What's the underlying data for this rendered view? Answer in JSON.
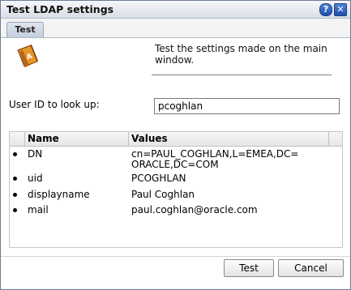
{
  "window": {
    "title": "Test LDAP settings",
    "help_glyph": "?",
    "close_glyph": "✕"
  },
  "tabs": [
    {
      "label": "Test",
      "selected": true
    }
  ],
  "info": {
    "icon": "address-book-icon",
    "text": "Test the settings made on the main window."
  },
  "lookup": {
    "label": "User ID to look up:",
    "value": "pcoghlan"
  },
  "results": {
    "columns": [
      "Name",
      "Values"
    ],
    "rows": [
      {
        "name": "DN",
        "value": "cn=PAUL_COGHLAN,L=EMEA,DC=\nORACLE,DC=COM"
      },
      {
        "name": "uid",
        "value": "PCOGHLAN"
      },
      {
        "name": "displayname",
        "value": "Paul Coghlan"
      },
      {
        "name": "mail",
        "value": "paul.coghlan@oracle.com"
      }
    ]
  },
  "buttons": {
    "test": "Test",
    "cancel": "Cancel"
  },
  "colors": {
    "title_button_blue": "#2a5cb8",
    "tab_bg": "#c4cedd",
    "icon_book": "#d9821a"
  }
}
